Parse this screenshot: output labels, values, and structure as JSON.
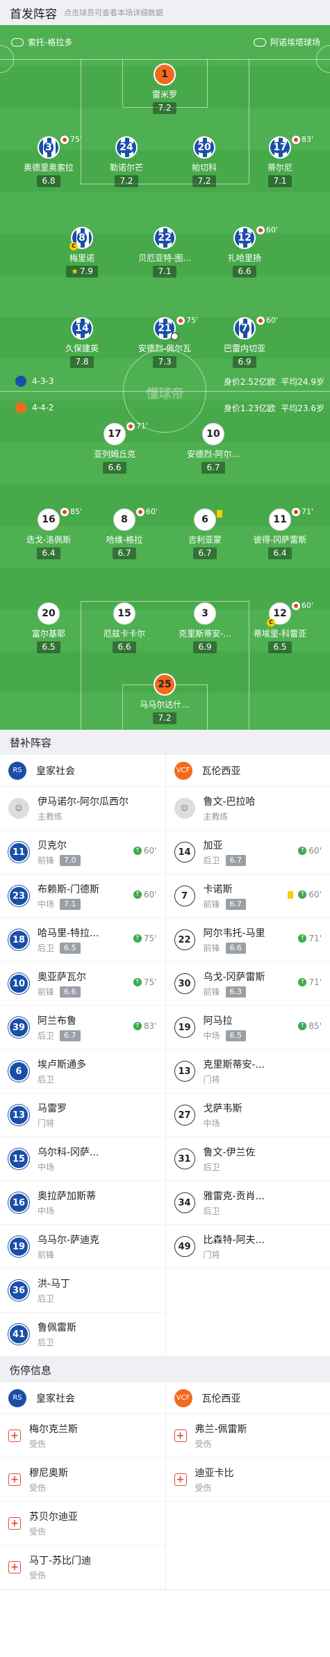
{
  "header": {
    "title": "首发阵容",
    "subtitle": "点击球员可查看本场详细数据"
  },
  "pitch": {
    "home_coach_label": "索托-格拉多",
    "venue_label": "阿诺埃塔球场",
    "watermark": "懂球帝",
    "home_formation": "4-3-3",
    "home_value": "身价2.52亿欧",
    "home_age": "平均24.9岁",
    "away_formation": "4-4-2",
    "away_value": "身价1.23亿欧",
    "away_age": "平均23.6岁",
    "home_players": [
      {
        "num": "1",
        "name": "雷米罗",
        "rating": "7.2"
      },
      {
        "num": "3",
        "name": "奥德里奥索拉",
        "rating": "6.8",
        "sub": "75'"
      },
      {
        "num": "24",
        "name": "勒诺尔芒",
        "rating": "7.2"
      },
      {
        "num": "20",
        "name": "帕切科",
        "rating": "7.2"
      },
      {
        "num": "17",
        "name": "蒂尔尼",
        "rating": "7.1",
        "sub": "83'"
      },
      {
        "num": "8",
        "name": "梅里诺",
        "rating": "7.9"
      },
      {
        "num": "22",
        "name": "贝厄亚特-图...",
        "rating": "7.1"
      },
      {
        "num": "12",
        "name": "扎哈里扬",
        "rating": "6.6",
        "sub": "60'"
      },
      {
        "num": "14",
        "name": "久保建英",
        "rating": "7.8"
      },
      {
        "num": "21",
        "name": "安德烈-佩尔瓦",
        "rating": "7.3",
        "sub": "75'"
      },
      {
        "num": "7",
        "name": "巴雷内切亚",
        "rating": "6.9",
        "sub": "60'"
      }
    ],
    "away_players": [
      {
        "num": "17",
        "name": "亚列姆丘克",
        "rating": "6.6",
        "sub": "71'"
      },
      {
        "num": "10",
        "name": "安德烈-阿尔...",
        "rating": "6.7"
      },
      {
        "num": "16",
        "name": "迭戈-洛佩斯",
        "rating": "6.4",
        "sub": "85'"
      },
      {
        "num": "8",
        "name": "哈维-格拉",
        "rating": "6.7",
        "sub": "60'"
      },
      {
        "num": "6",
        "name": "吉利亚蒙",
        "rating": "6.7"
      },
      {
        "num": "11",
        "name": "彼得-冈萨雷斯",
        "rating": "6.4",
        "sub": "71'"
      },
      {
        "num": "20",
        "name": "富尔基耶",
        "rating": "6.5"
      },
      {
        "num": "15",
        "name": "厄兹卡卡尔",
        "rating": "6.6"
      },
      {
        "num": "3",
        "name": "克里斯蒂安-...",
        "rating": "6.9"
      },
      {
        "num": "12",
        "name": "蒂埃里-科雷亚",
        "rating": "6.5",
        "sub": "60'"
      },
      {
        "num": "25",
        "name": "马马尔达什...",
        "rating": "7.2"
      }
    ]
  },
  "subs_section": {
    "title": "替补阵容",
    "home_team": "皇家社会",
    "away_team": "瓦伦西亚",
    "home_coach": {
      "name": "伊马诺尔-阿尔瓜西尔",
      "role": "主教练"
    },
    "away_coach": {
      "name": "鲁文-巴拉哈",
      "role": "主教练"
    },
    "home": [
      {
        "num": "11",
        "name": "贝克尔",
        "pos": "前锋",
        "rating": "7.0",
        "in": "60'"
      },
      {
        "num": "23",
        "name": "布赖斯-门德斯",
        "pos": "中场",
        "rating": "7.1",
        "in": "60'"
      },
      {
        "num": "18",
        "name": "哈马里-特拉...",
        "pos": "后卫",
        "rating": "6.5",
        "in": "75'"
      },
      {
        "num": "10",
        "name": "奥亚萨瓦尔",
        "pos": "前锋",
        "rating": "6.6",
        "in": "75'"
      },
      {
        "num": "39",
        "name": "阿兰布鲁",
        "pos": "后卫",
        "rating": "6.7",
        "in": "83'"
      },
      {
        "num": "6",
        "name": "埃卢斯通多",
        "pos": "后卫"
      },
      {
        "num": "13",
        "name": "马雷罗",
        "pos": "门将"
      },
      {
        "num": "15",
        "name": "乌尔科-冈萨...",
        "pos": "中场"
      },
      {
        "num": "16",
        "name": "奥拉萨加斯蒂",
        "pos": "中场"
      },
      {
        "num": "19",
        "name": "乌马尔-萨迪克",
        "pos": "前锋"
      },
      {
        "num": "36",
        "name": "洪-马丁",
        "pos": "后卫"
      },
      {
        "num": "41",
        "name": "鲁佩雷斯",
        "pos": "后卫"
      }
    ],
    "away": [
      {
        "num": "14",
        "name": "加亚",
        "pos": "后卫",
        "rating": "6.7",
        "in": "60'"
      },
      {
        "num": "7",
        "name": "卡诺斯",
        "pos": "前锋",
        "rating": "6.7",
        "in": "60'",
        "yellow": "yes"
      },
      {
        "num": "22",
        "name": "阿尔韦托-马里",
        "pos": "前锋",
        "rating": "6.6",
        "in": "71'"
      },
      {
        "num": "30",
        "name": "乌戈-冈萨雷斯",
        "pos": "前锋",
        "rating": "6.3",
        "in": "71'"
      },
      {
        "num": "19",
        "name": "阿马拉",
        "pos": "中场",
        "rating": "6.5",
        "in": "85'"
      },
      {
        "num": "13",
        "name": "克里斯蒂安-...",
        "pos": "门将"
      },
      {
        "num": "27",
        "name": "戈萨韦斯",
        "pos": "中场"
      },
      {
        "num": "31",
        "name": "鲁文-伊兰佐",
        "pos": "后卫"
      },
      {
        "num": "34",
        "name": "雅雷克-贡肖...",
        "pos": "后卫"
      },
      {
        "num": "49",
        "name": "比森特-阿夫...",
        "pos": "门将"
      }
    ]
  },
  "injury_section": {
    "title": "伤停信息",
    "home_team": "皇家社会",
    "away_team": "瓦伦西亚",
    "home": [
      {
        "name": "梅尔克兰斯",
        "status": "受伤"
      },
      {
        "name": "穆尼奥斯",
        "status": "受伤"
      },
      {
        "name": "苏贝尔迪亚",
        "status": "受伤"
      },
      {
        "name": "马丁-苏比门迪",
        "status": "受伤"
      }
    ],
    "away": [
      {
        "name": "弗兰-佩雷斯",
        "status": "受伤"
      },
      {
        "name": "迪亚卡比",
        "status": "受伤"
      }
    ]
  }
}
